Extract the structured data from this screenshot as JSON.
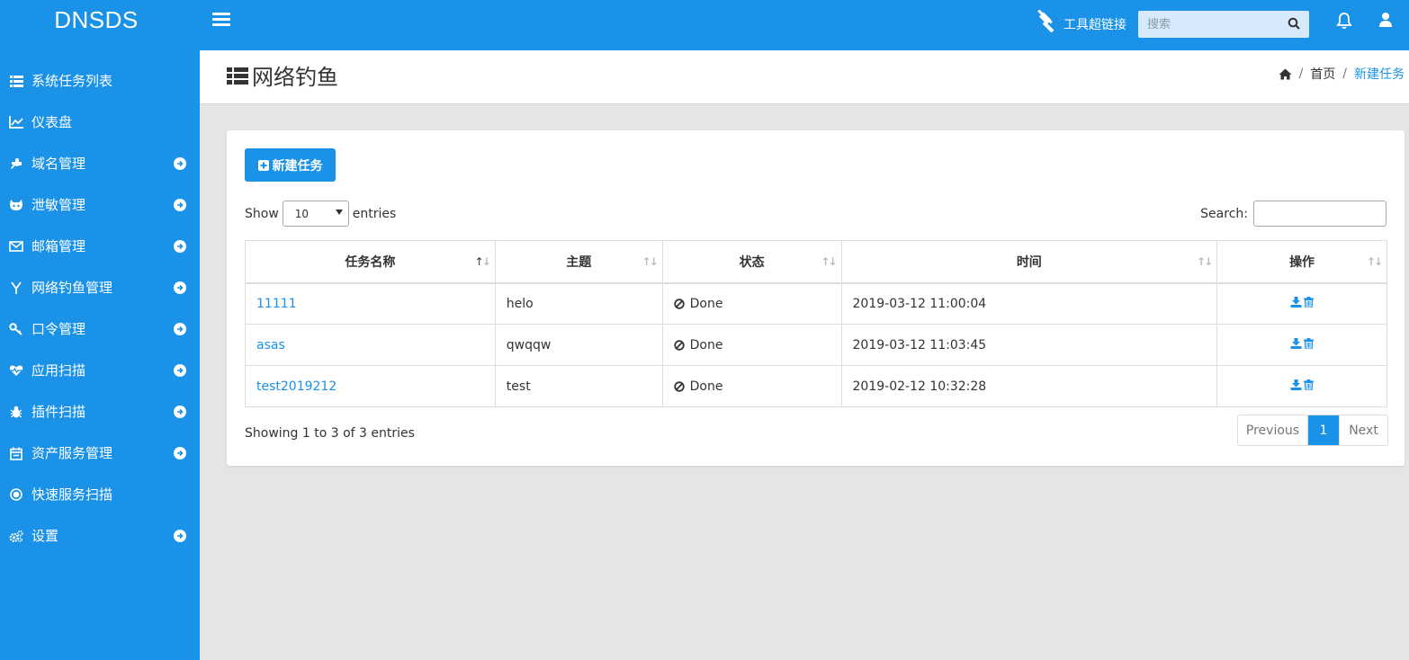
{
  "brand": "DNSDS",
  "topbar": {
    "tools_label": "工具超链接",
    "search_placeholder": "搜索"
  },
  "sidebar": {
    "items": [
      {
        "label": "系统任务列表",
        "icon": "list-icon",
        "arrow": false
      },
      {
        "label": "仪表盘",
        "icon": "line-chart-icon",
        "arrow": false
      },
      {
        "label": "域名管理",
        "icon": "puzzle-icon",
        "arrow": true
      },
      {
        "label": "泄敏管理",
        "icon": "github-icon",
        "arrow": true
      },
      {
        "label": "邮箱管理",
        "icon": "envelope-icon",
        "arrow": true
      },
      {
        "label": "网络钓鱼管理",
        "icon": "y-combinator-icon",
        "arrow": true
      },
      {
        "label": "口令管理",
        "icon": "key-icon",
        "arrow": true
      },
      {
        "label": "应用扫描",
        "icon": "heartbeat-icon",
        "arrow": true
      },
      {
        "label": "插件扫描",
        "icon": "bug-icon",
        "arrow": true
      },
      {
        "label": "资产服务管理",
        "icon": "calendar-icon",
        "arrow": true
      },
      {
        "label": "快速服务扫描",
        "icon": "dot-circle-icon",
        "arrow": false
      },
      {
        "label": "设置",
        "icon": "cogs-icon",
        "arrow": true
      }
    ]
  },
  "header": {
    "title": "网络钓鱼",
    "breadcrumb_home": "首页",
    "breadcrumb_current": "新建任务"
  },
  "card": {
    "new_task_label": "新建任务",
    "show_label": "Show",
    "entries_label": "entries",
    "page_size": "10",
    "search_label": "Search:",
    "columns": [
      "任务名称",
      "主题",
      "状态",
      "时间",
      "操作"
    ],
    "rows": [
      {
        "name": "11111",
        "subject": "helo",
        "status": "Done",
        "time": "2019-03-12 11:00:04"
      },
      {
        "name": "asas",
        "subject": "qwqqw",
        "status": "Done",
        "time": "2019-03-12 11:03:45"
      },
      {
        "name": "test2019212",
        "subject": "test",
        "status": "Done",
        "time": "2019-02-12 10:32:28"
      }
    ],
    "info": "Showing 1 to 3 of 3 entries",
    "pager": {
      "previous": "Previous",
      "current": "1",
      "next": "Next"
    }
  },
  "colors": {
    "accent": "#1a92e8",
    "background": "#e5e5e5"
  }
}
